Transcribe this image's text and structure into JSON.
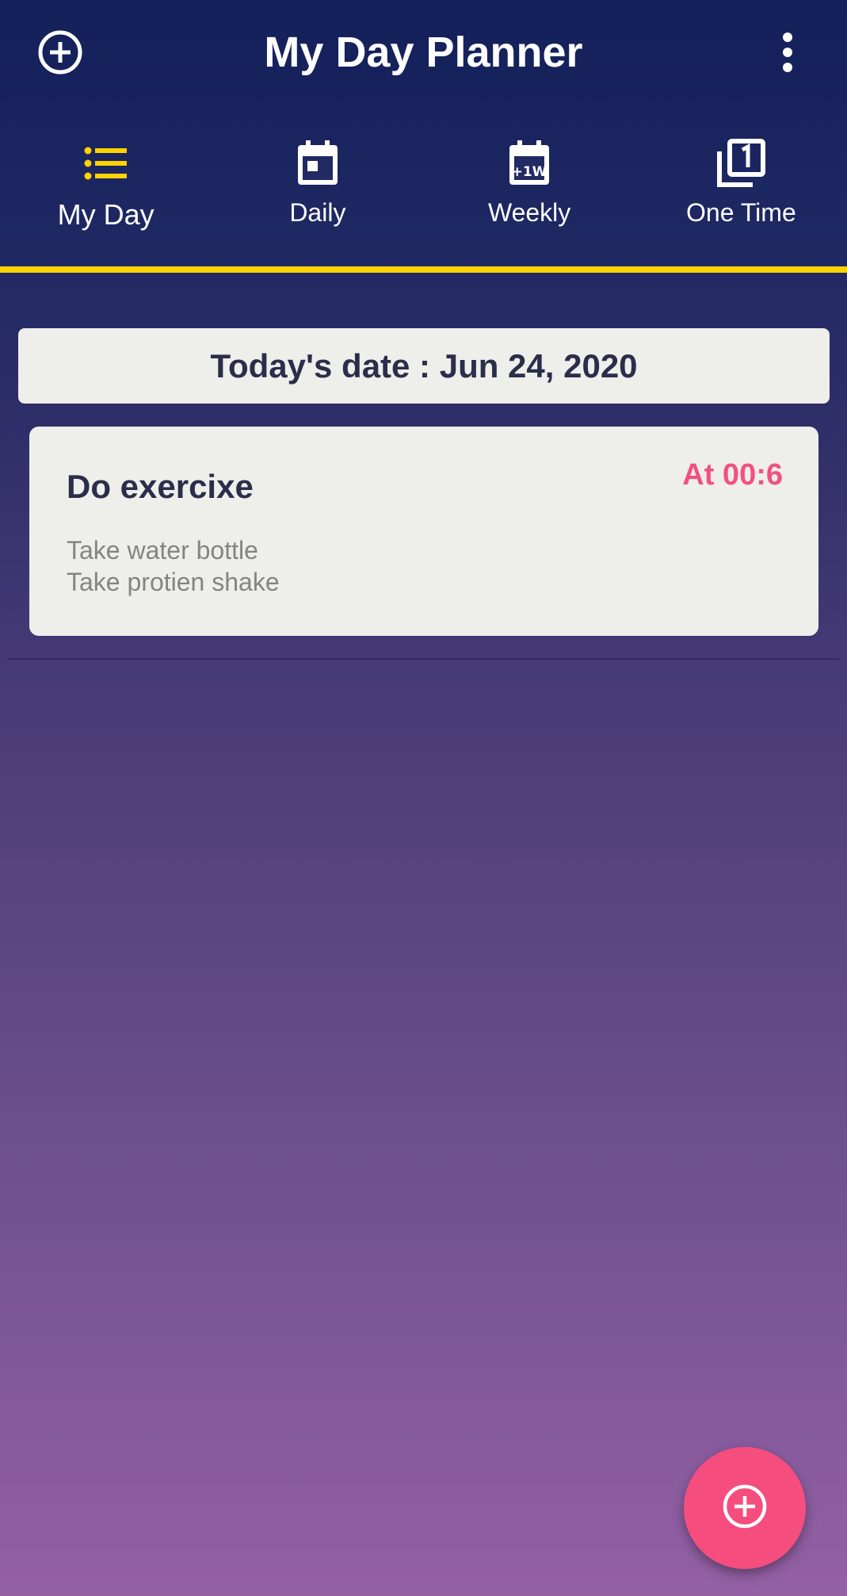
{
  "app_bar": {
    "title": "My Day Planner",
    "add_icon": "add-circle-icon",
    "menu_icon": "more-vertical-icon"
  },
  "tabs": [
    {
      "label": "My Day",
      "icon": "list-icon",
      "active": true
    },
    {
      "label": "Daily",
      "icon": "calendar-day-icon",
      "active": false
    },
    {
      "label": "Weekly",
      "icon": "calendar-week-icon",
      "active": false
    },
    {
      "label": "One Time",
      "icon": "filter-1-icon",
      "active": false
    }
  ],
  "date_banner": {
    "text": "Today's date : Jun 24, 2020"
  },
  "tasks": [
    {
      "title": "Do exercixe",
      "time": "At 00:6",
      "notes": [
        "Take water bottle",
        "Take protien shake"
      ]
    }
  ],
  "fab": {
    "icon": "add-circle-icon"
  },
  "colors": {
    "accent_yellow": "#ffd200",
    "accent_pink": "#f54e7e",
    "card_bg": "#eeeeea",
    "text_dark": "#2b2e4a"
  }
}
